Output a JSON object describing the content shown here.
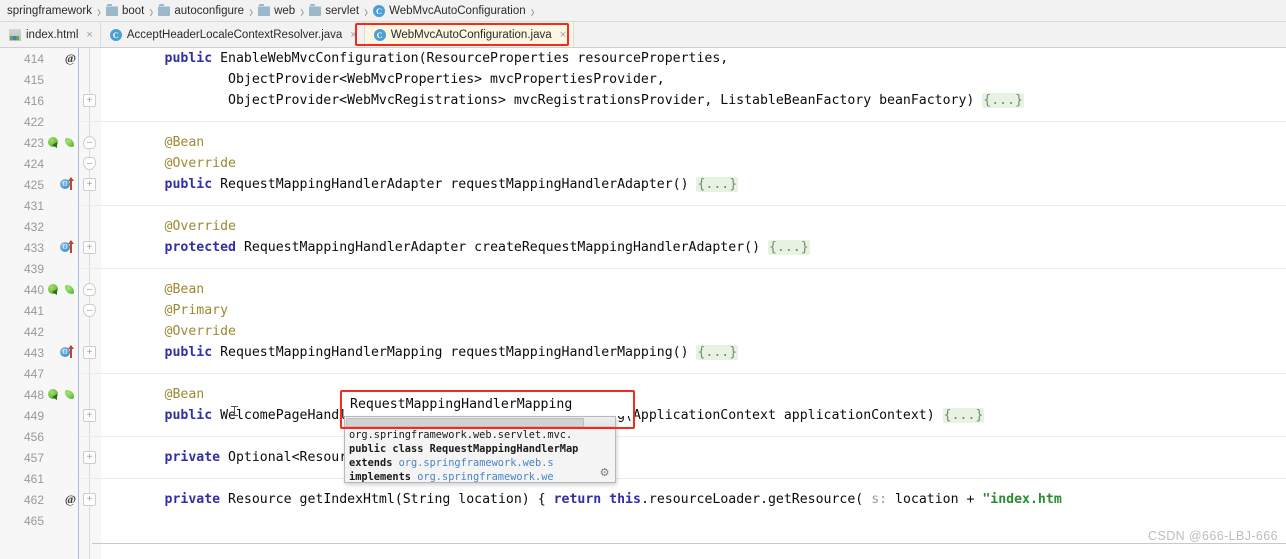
{
  "breadcrumb": {
    "items": [
      {
        "label": "springframework",
        "icon": ""
      },
      {
        "label": "boot",
        "icon": "folder-icon"
      },
      {
        "label": "autoconfigure",
        "icon": "folder-icon"
      },
      {
        "label": "web",
        "icon": "folder-icon"
      },
      {
        "label": "servlet",
        "icon": "folder-icon"
      },
      {
        "label": "WebMvcAutoConfiguration",
        "icon": "class-icon"
      }
    ],
    "separator": "›",
    "class_icon_glyph": "C"
  },
  "tabs": {
    "items": [
      {
        "label": "index.html",
        "icon": "html-file-icon",
        "close": "×",
        "state": "inactive"
      },
      {
        "label": "AcceptHeaderLocaleContextResolver.java",
        "icon": "java-class-icon",
        "close": "×",
        "state": "inactive"
      },
      {
        "label": "WebMvcAutoConfiguration.java",
        "icon": "java-class-icon",
        "close": "×",
        "state": "selected"
      }
    ],
    "java_icon_glyph": "C"
  },
  "editor": {
    "lines": [
      {
        "num": "414",
        "marks": [
          "at-icon"
        ],
        "fold": "",
        "sep": false,
        "html": "        <span class=\"kw\">public</span> EnableWebMvcConfiguration(ResourceProperties resourceProperties,"
      },
      {
        "num": "415",
        "marks": [],
        "fold": "",
        "sep": false,
        "html": "                ObjectProvider&lt;WebMvcProperties&gt; mvcPropertiesProvider,"
      },
      {
        "num": "416",
        "marks": [],
        "fold": "plus",
        "sep": false,
        "html": "                ObjectProvider&lt;WebMvcRegistrations&gt; mvcRegistrationsProvider, ListableBeanFactory beanFactory) <span class=\"fold\">{...}</span>"
      },
      {
        "num": "422",
        "marks": [],
        "fold": "",
        "sep": true,
        "html": ""
      },
      {
        "num": "423",
        "marks": [
          "bean-icon",
          "bean2-icon"
        ],
        "fold": "minus-round",
        "sep": false,
        "html": "        <span class=\"ann\">@Bean</span>"
      },
      {
        "num": "424",
        "marks": [],
        "fold": "minus-round2",
        "sep": false,
        "html": "        <span class=\"ann\">@Override</span>"
      },
      {
        "num": "425",
        "marks": [
          "override-icon"
        ],
        "fold": "plus",
        "sep": false,
        "html": "        <span class=\"kw\">public</span> RequestMappingHandlerAdapter requestMappingHandlerAdapter() <span class=\"fold\">{...}</span>"
      },
      {
        "num": "431",
        "marks": [],
        "fold": "",
        "sep": true,
        "html": ""
      },
      {
        "num": "432",
        "marks": [],
        "fold": "",
        "sep": false,
        "html": "        <span class=\"ann\">@Override</span>"
      },
      {
        "num": "433",
        "marks": [
          "override-icon"
        ],
        "fold": "plus",
        "sep": false,
        "html": "        <span class=\"kw\">protected</span> RequestMappingHandlerAdapter createRequestMappingHandlerAdapter() <span class=\"fold\">{...}</span>"
      },
      {
        "num": "439",
        "marks": [],
        "fold": "",
        "sep": true,
        "html": ""
      },
      {
        "num": "440",
        "marks": [
          "bean-icon",
          "bean2-icon"
        ],
        "fold": "minus-round",
        "sep": false,
        "html": "        <span class=\"ann\">@Bean</span>"
      },
      {
        "num": "441",
        "marks": [],
        "fold": "minus-round2",
        "sep": false,
        "html": "        <span class=\"ann\">@Primary</span>"
      },
      {
        "num": "442",
        "marks": [],
        "fold": "",
        "sep": false,
        "html": "        <span class=\"ann\">@Override</span>"
      },
      {
        "num": "443",
        "marks": [
          "override-icon"
        ],
        "fold": "plus",
        "sep": false,
        "html": "        <span class=\"kw\">public</span> RequestMappingHandlerMapping requestMappingHandlerMapping() <span class=\"fold\">{...}</span>"
      },
      {
        "num": "447",
        "marks": [],
        "fold": "",
        "sep": true,
        "html": ""
      },
      {
        "num": "448",
        "marks": [
          "bean-icon",
          "bean2-icon"
        ],
        "fold": "",
        "sep": false,
        "html": "        <span class=\"ann\">@Bean</span>"
      },
      {
        "num": "449",
        "marks": [],
        "fold": "plus",
        "sep": false,
        "html": "        <span class=\"kw\">public</span> WelcomePageHandlerMapping welcomePageHandlerMapping(ApplicationContext applicationContext) <span class=\"fold\">{...}</span>"
      },
      {
        "num": "456",
        "marks": [],
        "fold": "",
        "sep": true,
        "html": ""
      },
      {
        "num": "457",
        "marks": [],
        "fold": "plus",
        "sep": false,
        "html": "        <span class=\"kw\">private</span> Optional&lt;Resource&gt; getWelcomePage() <span class=\"fold\">{...}</span>"
      },
      {
        "num": "461",
        "marks": [],
        "fold": "",
        "sep": true,
        "html": ""
      },
      {
        "num": "462",
        "marks": [
          "at-icon"
        ],
        "fold": "plus",
        "sep": false,
        "html": "        <span class=\"kw\">private</span> Resource getIndexHtml(String location) { <span class=\"kw\">return</span> <span class=\"kw\">this</span>.resourceLoader.getResource( <span class=\"hint\">s:</span> location + <span class=\"str\">\"index.htm</span>"
      },
      {
        "num": "465",
        "marks": [],
        "fold": "",
        "sep": false,
        "html": ""
      }
    ]
  },
  "highlight": {
    "identifier_text": "RequestMappingHandlerMapping",
    "box_color": "#f32a1e"
  },
  "doc_popup": {
    "lines": [
      {
        "html": "org.springframework.web.servlet.mvc.<span class=\"lnk\">&nbsp;</span>"
      },
      {
        "html": "<span class=\"b\">public class RequestMappingHandlerMap</span>"
      },
      {
        "html": "<span class=\"b\">extends</span> <span class=\"lnk\">org.springframework.web.s</span>"
      },
      {
        "html": "<span class=\"b\">implements</span> <span class=\"lnk\">org.springframework.we</span>"
      }
    ],
    "gear_glyph": "⚙"
  },
  "watermark": {
    "text": "CSDN @666-LBJ-666"
  }
}
